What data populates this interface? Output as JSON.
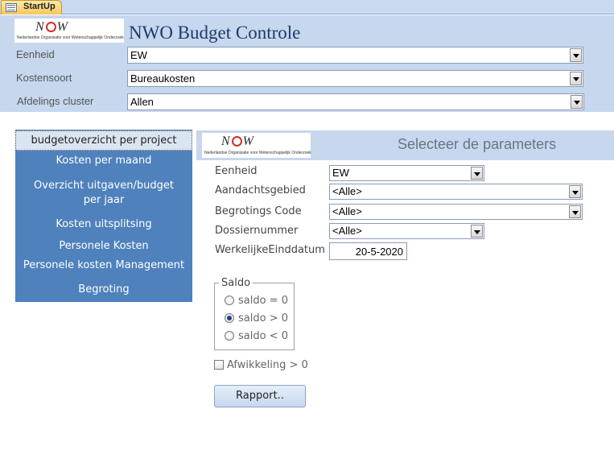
{
  "tab": {
    "label": "StartUp"
  },
  "logo": {
    "word_n": "N",
    "word_w": "W",
    "tagline": "Nederlandse Organisatie voor Wetenschappelijk Onderzoek"
  },
  "header": {
    "title": "NWO Budget Controle",
    "filters": [
      {
        "label": "Eenheid",
        "value": "EW"
      },
      {
        "label": "Kostensoort",
        "value": "Bureaukosten"
      },
      {
        "label": "Afdelings cluster",
        "value": "Allen"
      }
    ]
  },
  "menu": {
    "items": [
      "budgetoverzicht per project",
      "Kosten per maand",
      "Overzicht uitgaven/budget per jaar",
      "Kosten uitsplitsing",
      "Personele Kosten",
      "Personele kosten Management",
      "Begroting"
    ]
  },
  "params": {
    "title": "Selecteer de parameters",
    "eenheid": {
      "label": "Eenheid",
      "value": "EW"
    },
    "aandachtsgebied": {
      "label": "Aandachtsgebied",
      "value": "<Alle>"
    },
    "begrotingscode": {
      "label": "Begrotings Code",
      "value": "<Alle>"
    },
    "dossiernummer": {
      "label": "Dossiernummer",
      "value": "<Alle>"
    },
    "einddatum": {
      "label": "WerkelijkeEinddatum",
      "value": "20-5-2020"
    }
  },
  "saldo": {
    "legend": "Saldo",
    "options": [
      {
        "label": "saldo = 0",
        "checked": false
      },
      {
        "label": "saldo > 0",
        "checked": true
      },
      {
        "label": "saldo < 0",
        "checked": false
      }
    ]
  },
  "afwikkeling": {
    "label": "Afwikkeling > 0",
    "checked": false
  },
  "report_button": "Rapport..",
  "colors": {
    "header_band": "#c6d7ee",
    "menu": "#4f81bd",
    "title": "#1f3a6b",
    "logo_accent": "#d4302b"
  }
}
